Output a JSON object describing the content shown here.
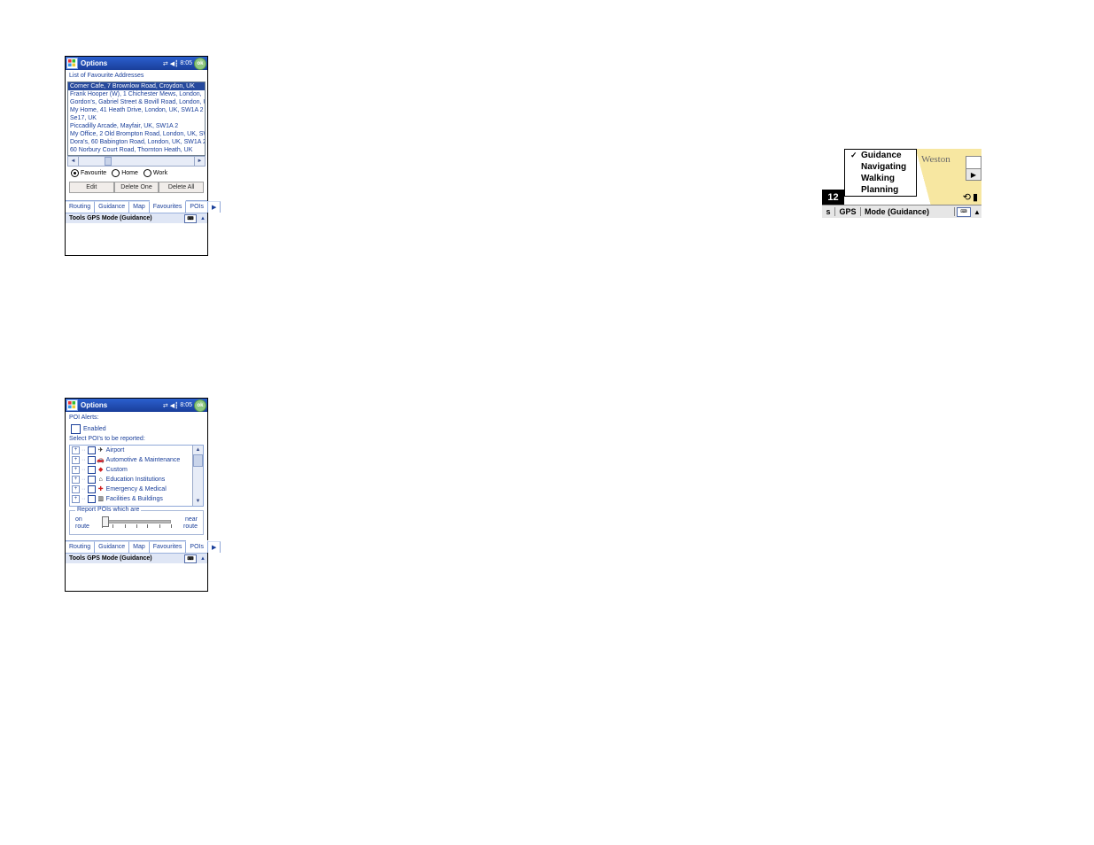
{
  "screen1": {
    "title": "Options",
    "time": "8:05",
    "ok": "ok",
    "heading": "List of Favourite Addresses",
    "addresses": [
      "Corner Cafe, 7 Brownlow Road, Croydon, UK",
      "Frank Hooper (W), 1 Chichester Mews, London,",
      "Gordon's, Gabriel Street & Bovill Road, London, U",
      "My Home, 41 Heath Drive, London, UK, SW1A 2",
      "Se17, UK",
      "Piccadilly Arcade, Mayfair, UK, SW1A 2",
      "My Office, 2 Old Brompton Road, London, UK, SW",
      "Dora's, 60 Babington Road, London, UK, SW1A 2",
      "60 Norbury Court Road, Thornton Heath, UK"
    ],
    "selected_index": 0,
    "radios": {
      "favourite": "Favourite",
      "home": "Home",
      "work": "Work"
    },
    "buttons": {
      "edit": "Edit",
      "del1": "Delete One",
      "delall": "Delete All"
    },
    "tabs": [
      "Routing",
      "Guidance",
      "Map",
      "Favourites",
      "POIs"
    ],
    "active_tab": 3,
    "menubar": "Tools GPS Mode (Guidance)"
  },
  "screen2": {
    "title": "Options",
    "time": "8:05",
    "ok": "ok",
    "heading": "POI Alerts:",
    "enabled_label": "Enabled",
    "subheading": "Select POI's to be reported:",
    "tree": [
      {
        "label": "Airport",
        "icon": "✈",
        "iconColor": "#000"
      },
      {
        "label": "Automotive & Maintenance",
        "icon": "🚗",
        "iconColor": "#000"
      },
      {
        "label": "Custom",
        "icon": "◆",
        "iconColor": "#d02020"
      },
      {
        "label": "Education Institutions",
        "icon": "⌂",
        "iconColor": "#000"
      },
      {
        "label": "Emergency & Medical",
        "icon": "✚",
        "iconColor": "#d02020"
      },
      {
        "label": "Facilities & Buildings",
        "icon": "▥",
        "iconColor": "#000"
      }
    ],
    "fieldset_legend": "Report POIs which are",
    "slider_left": "on\nroute",
    "slider_right": "near\nroute",
    "tabs": [
      "Routing",
      "Guidance",
      "Map",
      "Favourites",
      "POIs"
    ],
    "active_tab": 4,
    "menubar": "Tools GPS Mode (Guidance)"
  },
  "snippet": {
    "menu": [
      "Guidance",
      "Navigating",
      "Walking",
      "Planning"
    ],
    "menu_checked": 0,
    "town": "Weston",
    "left_black": "12",
    "bar_prefix": "s",
    "bar_gps": "GPS",
    "bar_mode": "Mode (Guidance)"
  }
}
